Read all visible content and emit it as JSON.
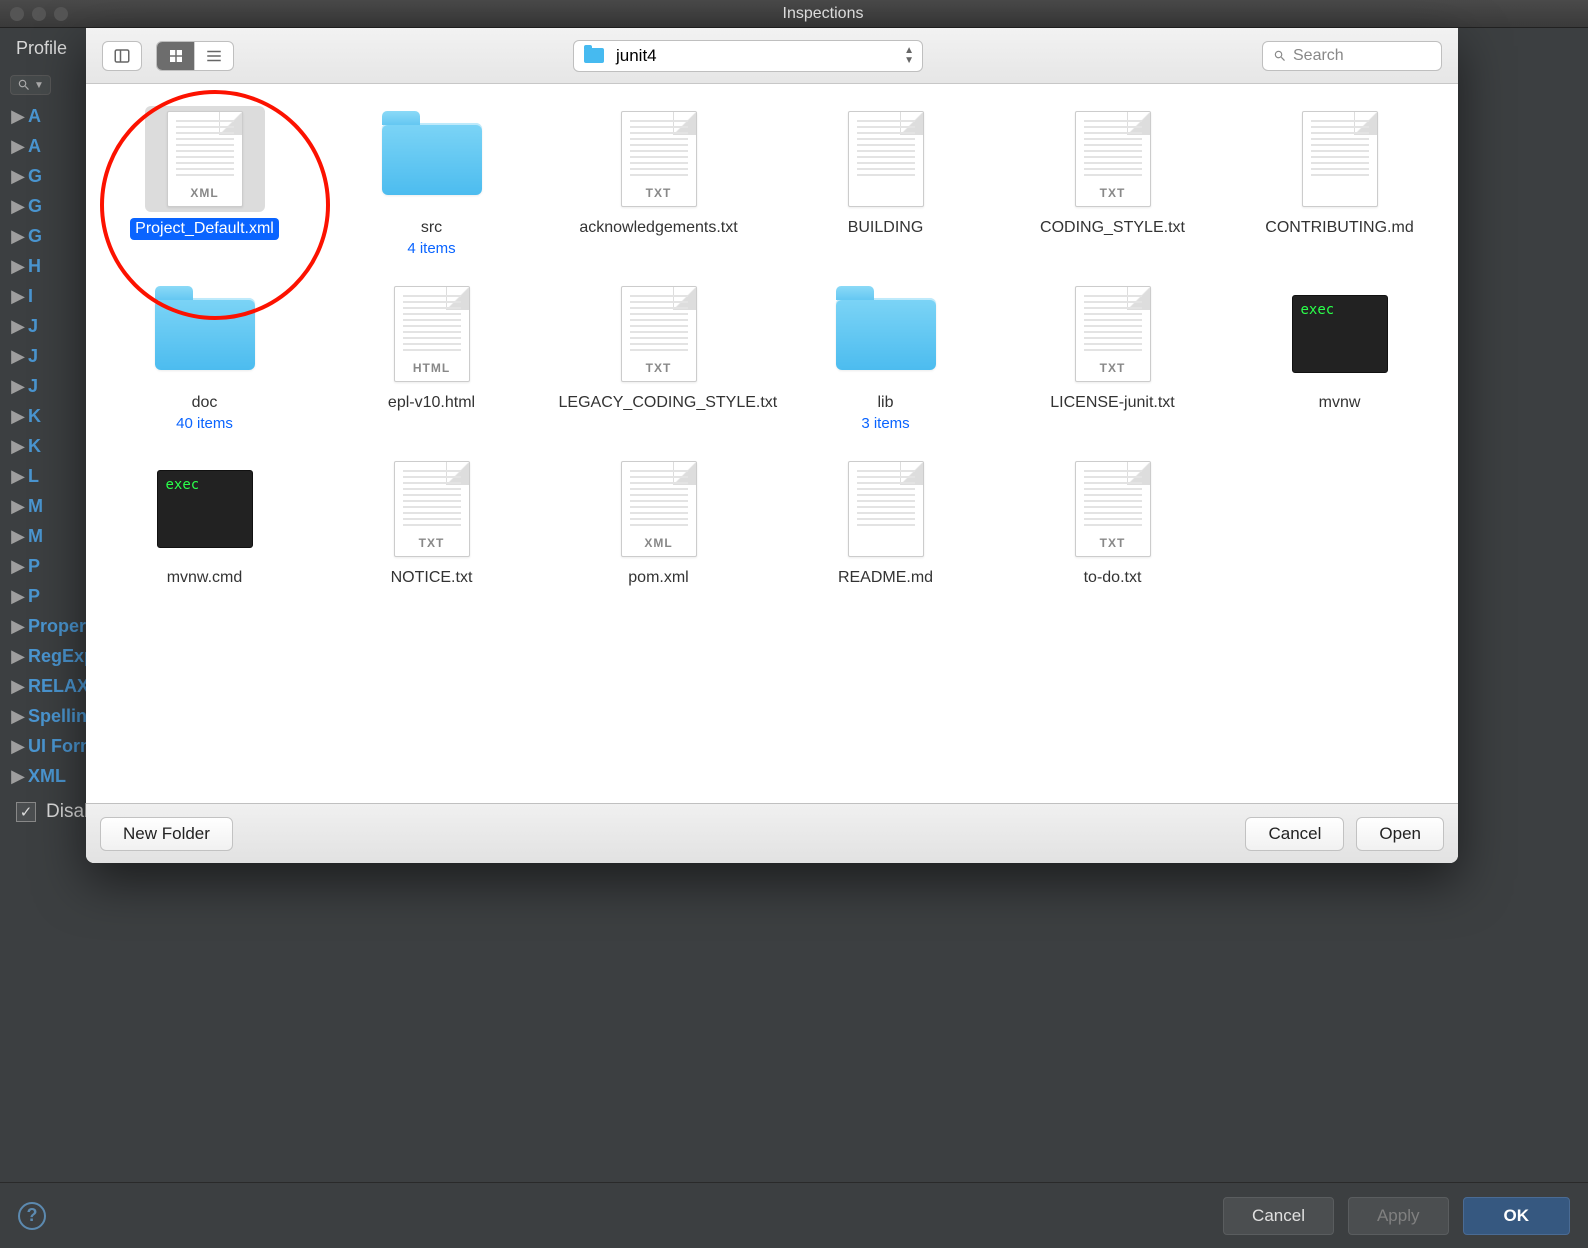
{
  "window": {
    "title": "Inspections",
    "profile_label": "Profile"
  },
  "dark_buttons": {
    "cancel": "Cancel",
    "apply": "Apply",
    "ok": "OK"
  },
  "disable_label": "Disable new inspections by default",
  "disable_checked": true,
  "search_placeholder": "",
  "tree_items": [
    {
      "label": "A",
      "truncated": true
    },
    {
      "label": "A",
      "truncated": true
    },
    {
      "label": "G",
      "truncated": true
    },
    {
      "label": "G",
      "truncated": true
    },
    {
      "label": "G",
      "truncated": true
    },
    {
      "label": "H",
      "truncated": true
    },
    {
      "label": "I",
      "truncated": true
    },
    {
      "label": "J",
      "truncated": true
    },
    {
      "label": "J",
      "truncated": true
    },
    {
      "label": "J",
      "truncated": true
    },
    {
      "label": "K",
      "truncated": true
    },
    {
      "label": "K",
      "truncated": true
    },
    {
      "label": "L",
      "truncated": true
    },
    {
      "label": "M",
      "truncated": true
    },
    {
      "label": "M",
      "truncated": true
    },
    {
      "label": "P",
      "truncated": true
    },
    {
      "label": "P",
      "truncated": true
    },
    {
      "label": "Properties Files"
    },
    {
      "label": "RegExp"
    },
    {
      "label": "RELAX NG"
    },
    {
      "label": "Spelling"
    },
    {
      "label": "UI Form"
    },
    {
      "label": "XML"
    }
  ],
  "finder": {
    "path_label": "junit4",
    "search_placeholder": "Search",
    "buttons": {
      "new_folder": "New Folder",
      "cancel": "Cancel",
      "open": "Open"
    },
    "view_mode": "icons",
    "items": [
      {
        "name": "Project_Default.xml",
        "type": "xml",
        "selected": true,
        "tag": "XML"
      },
      {
        "name": "src",
        "type": "folder",
        "sub": "4 items"
      },
      {
        "name": "acknowledgements.txt",
        "type": "txt",
        "tag": "TXT"
      },
      {
        "name": "BUILDING",
        "type": "blank"
      },
      {
        "name": "CODING_STYLE.txt",
        "type": "txt",
        "tag": "TXT"
      },
      {
        "name": "CONTRIBUTING.md",
        "type": "blank"
      },
      {
        "name": "doc",
        "type": "folder",
        "sub": "40 items"
      },
      {
        "name": "epl-v10.html",
        "type": "html",
        "tag": "HTML"
      },
      {
        "name": "LEGACY_CODING_STYLE.txt",
        "type": "txt",
        "tag": "TXT"
      },
      {
        "name": "lib",
        "type": "folder",
        "sub": "3 items"
      },
      {
        "name": "LICENSE-junit.txt",
        "type": "txt",
        "tag": "TXT"
      },
      {
        "name": "mvnw",
        "type": "exec"
      },
      {
        "name": "mvnw.cmd",
        "type": "exec"
      },
      {
        "name": "NOTICE.txt",
        "type": "txt",
        "tag": "TXT"
      },
      {
        "name": "pom.xml",
        "type": "xml",
        "tag": "XML"
      },
      {
        "name": "README.md",
        "type": "blank"
      },
      {
        "name": "to-do.txt",
        "type": "txt",
        "tag": "TXT"
      }
    ]
  },
  "annotation": {
    "shape": "circle",
    "color": "#fc1200"
  }
}
